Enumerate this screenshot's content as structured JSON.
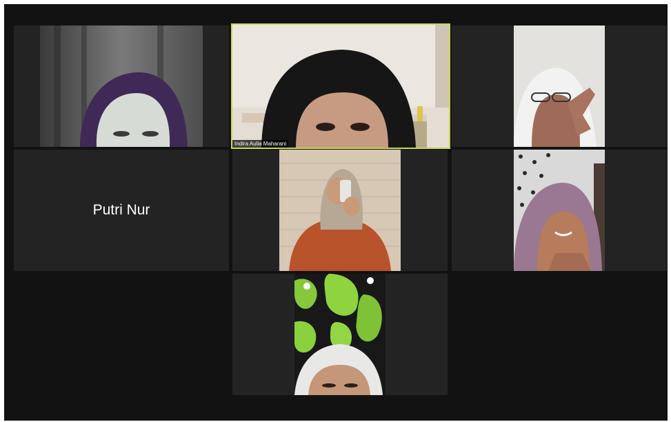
{
  "meeting": {
    "participants": [
      {
        "id": "p1",
        "display_name": "",
        "video_on": true,
        "active_speaker": false
      },
      {
        "id": "p2",
        "display_name": "Indira Aulia Maharani",
        "video_on": true,
        "active_speaker": true
      },
      {
        "id": "p3",
        "display_name": "",
        "video_on": true,
        "active_speaker": false
      },
      {
        "id": "p4",
        "display_name": "Putri Nur",
        "video_on": false,
        "active_speaker": false
      },
      {
        "id": "p5",
        "display_name": "",
        "video_on": true,
        "active_speaker": false
      },
      {
        "id": "p6",
        "display_name": "",
        "video_on": true,
        "active_speaker": false
      },
      {
        "id": "p7",
        "display_name": "",
        "video_on": true,
        "active_speaker": false
      }
    ],
    "colors": {
      "background": "#121212",
      "tile": "#232323",
      "active_speaker_border": "#c9d94c"
    }
  }
}
